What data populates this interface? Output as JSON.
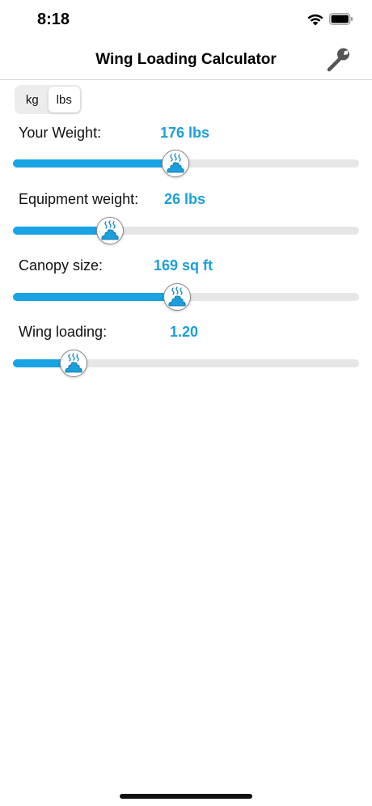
{
  "status_bar": {
    "time": "8:18"
  },
  "nav": {
    "title": "Wing Loading Calculator",
    "settings_icon": "wrench-icon"
  },
  "units": {
    "options": [
      "kg",
      "lbs"
    ],
    "selected": "lbs"
  },
  "rows": [
    {
      "label": "Your Weight:",
      "value": "176 lbs",
      "level": 0.47
    },
    {
      "label": "Equipment weight:",
      "value": "26 lbs",
      "level": 0.28
    },
    {
      "label": "Canopy size:",
      "value": "169 sq ft",
      "level": 0.475
    },
    {
      "label": "Wing loading:",
      "value": "1.20",
      "level": 0.175
    }
  ],
  "colors": {
    "accent": "#1a9fdc",
    "fill": "#1aa3e3",
    "track": "#e6e6e6"
  },
  "thumb_icon": "steaming-pile-icon"
}
